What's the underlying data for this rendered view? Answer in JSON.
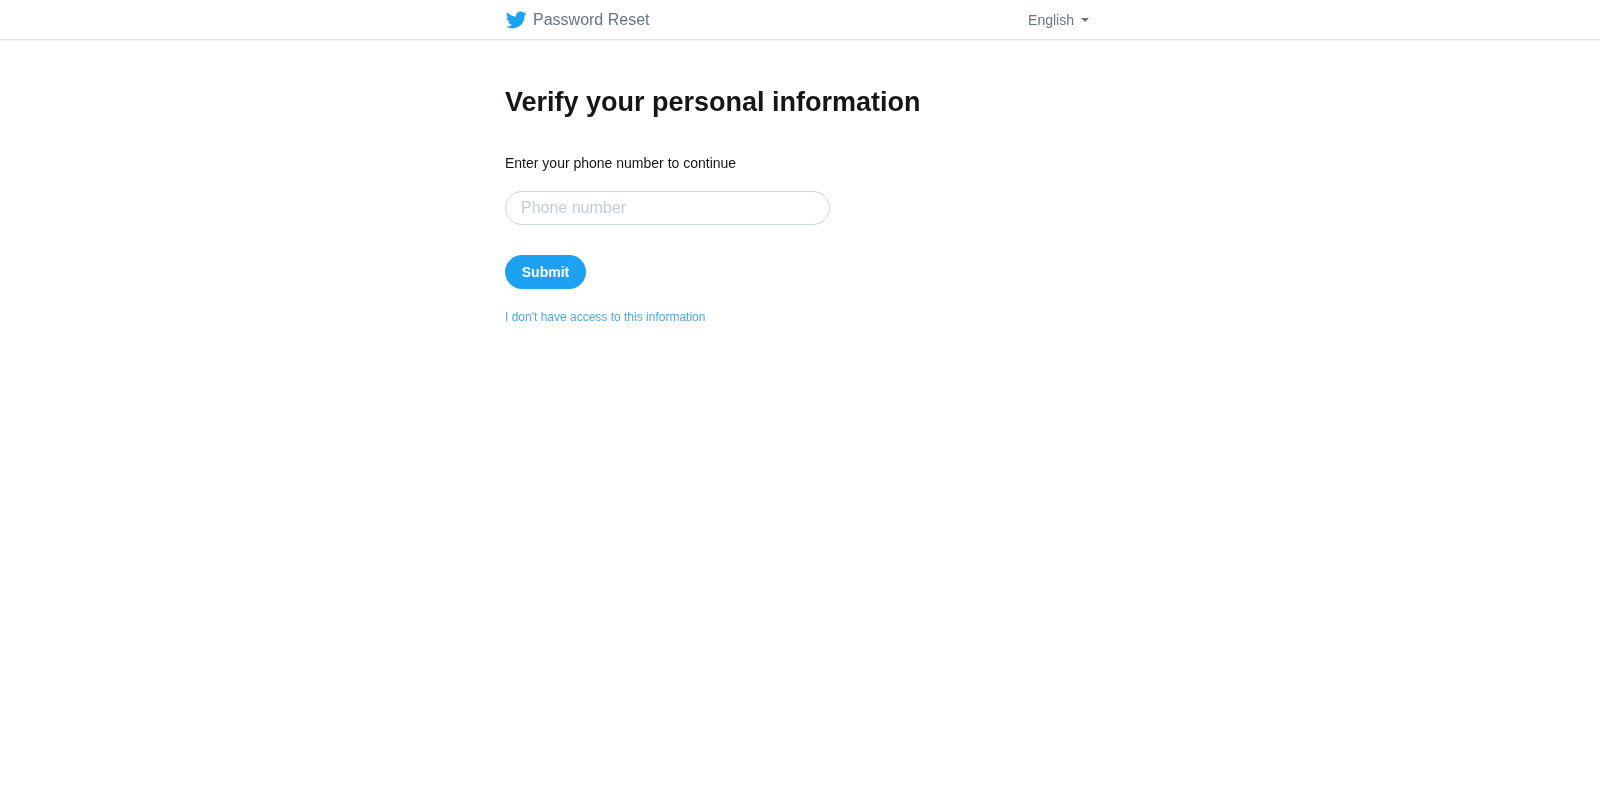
{
  "header": {
    "title": "Password Reset",
    "language": {
      "label": "English"
    }
  },
  "main": {
    "heading": "Verify your personal information",
    "prompt": "Enter your phone number to continue",
    "phone_field": {
      "placeholder": "Phone number"
    },
    "submit_button": {
      "label": "Submit"
    },
    "help_link": {
      "label": "I don't have access to this information"
    }
  }
}
